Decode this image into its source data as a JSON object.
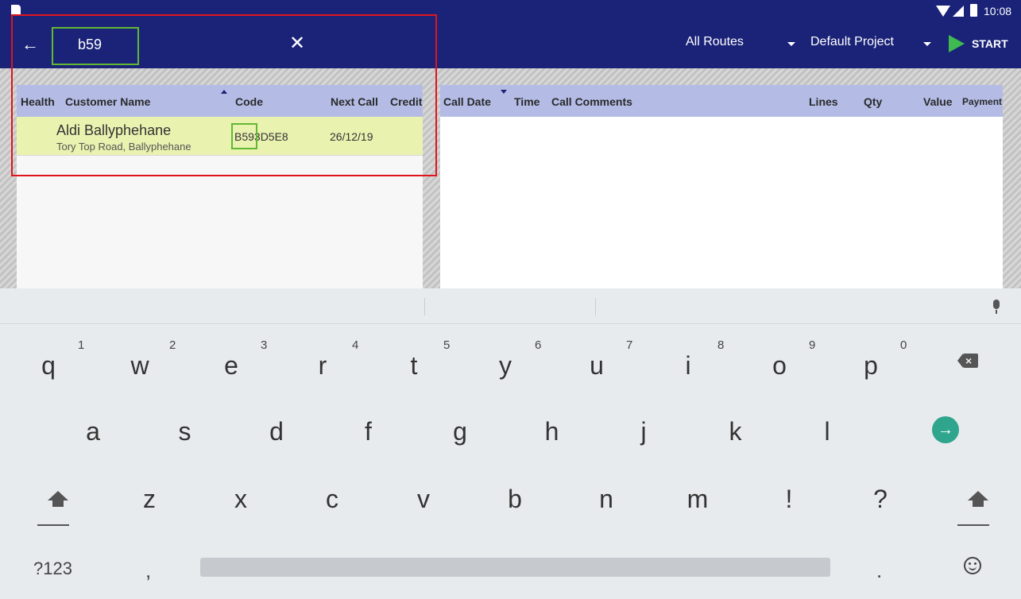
{
  "status": {
    "time": "10:08"
  },
  "toolbar": {
    "search_value": "b59",
    "routes_label": "All Routes",
    "project_label": "Default Project",
    "start_label": "START"
  },
  "customer_table": {
    "columns": [
      "Health",
      "Customer Name",
      "Code",
      "Next Call",
      "Credit"
    ],
    "rows": [
      {
        "name": "Aldi Ballyphehane",
        "address": "Tory Top Road, Ballyphehane",
        "code": "B593D5E8",
        "next_call": "26/12/19"
      }
    ]
  },
  "call_table": {
    "columns": [
      "Call Date",
      "Time",
      "Call Comments",
      "Lines",
      "Qty",
      "Value",
      "Payment"
    ]
  },
  "keyboard": {
    "row1": [
      {
        "ch": "q",
        "num": "1"
      },
      {
        "ch": "w",
        "num": "2"
      },
      {
        "ch": "e",
        "num": "3"
      },
      {
        "ch": "r",
        "num": "4"
      },
      {
        "ch": "t",
        "num": "5"
      },
      {
        "ch": "y",
        "num": "6"
      },
      {
        "ch": "u",
        "num": "7"
      },
      {
        "ch": "i",
        "num": "8"
      },
      {
        "ch": "o",
        "num": "9"
      },
      {
        "ch": "p",
        "num": "0"
      }
    ],
    "row2": [
      "a",
      "s",
      "d",
      "f",
      "g",
      "h",
      "j",
      "k",
      "l"
    ],
    "row3": [
      "z",
      "x",
      "c",
      "v",
      "b",
      "n",
      "m",
      "!",
      "?"
    ],
    "symbols_label": "?123",
    "comma": ",",
    "period": "."
  },
  "icons": {
    "back": "back-arrow-icon",
    "clear": "close-icon",
    "play": "play-icon",
    "mic": "microphone-icon",
    "enter": "enter-arrow-icon",
    "shift": "shift-icon",
    "backspace": "backspace-icon",
    "emoji": "emoji-icon"
  },
  "colors": {
    "app_bar": "#1a2378",
    "header_row": "#b4bce6",
    "selected_row": "#eaf2b0",
    "start_play": "#3fb950",
    "enter_key": "#2ea58c",
    "annotation_red": "#e0141e",
    "annotation_green": "#62b833"
  }
}
